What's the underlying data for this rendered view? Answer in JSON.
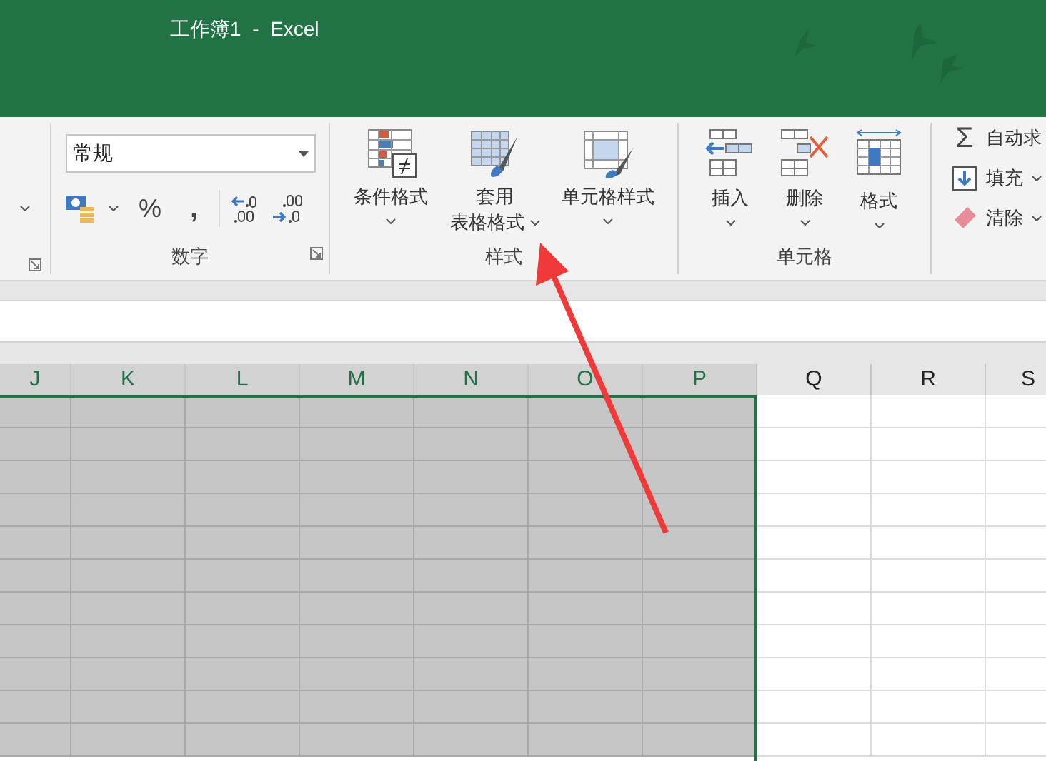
{
  "window": {
    "title": "工作簿1  -  Excel"
  },
  "ribbon": {
    "number_group": {
      "format_value": "常规",
      "percent": "%",
      "comma": ",",
      "label": "数字"
    },
    "styles_group": {
      "buttons": [
        {
          "kind": "conditional",
          "lines": [
            "条件格式"
          ]
        },
        {
          "kind": "table",
          "lines": [
            "套用",
            "表格格式"
          ]
        },
        {
          "kind": "cell",
          "lines": [
            "单元格样式"
          ]
        }
      ],
      "label": "样式"
    },
    "cells_group": {
      "buttons": [
        {
          "kind": "insert",
          "label": "插入"
        },
        {
          "kind": "delete",
          "label": "删除"
        },
        {
          "kind": "format",
          "label": "格式"
        }
      ],
      "label": "单元格"
    },
    "editing_group": {
      "items": [
        {
          "kind": "sum",
          "icon": "Σ",
          "label": "自动求"
        },
        {
          "kind": "fill",
          "label": "填充"
        },
        {
          "kind": "clear",
          "label": "清除"
        }
      ]
    }
  },
  "sheet": {
    "columns": [
      {
        "label": "J",
        "selected": true
      },
      {
        "label": "K",
        "selected": true
      },
      {
        "label": "L",
        "selected": true
      },
      {
        "label": "M",
        "selected": true
      },
      {
        "label": "N",
        "selected": true
      },
      {
        "label": "O",
        "selected": true
      },
      {
        "label": "P",
        "selected": true
      },
      {
        "label": "Q",
        "selected": false
      },
      {
        "label": "R",
        "selected": false
      },
      {
        "label": "S",
        "selected": false
      }
    ]
  }
}
